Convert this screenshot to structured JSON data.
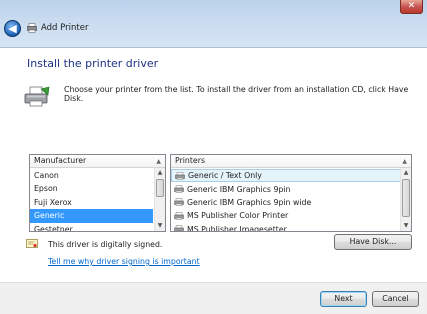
{
  "window": {
    "title": "Add Printer",
    "close_label": "✕"
  },
  "page": {
    "heading": "Install the printer driver",
    "instruction": "Choose your printer from the list. To install the driver from an installation CD, click Have Disk."
  },
  "manufacturer_list": {
    "header": "Manufacturer",
    "items": [
      "Canon",
      "Epson",
      "Fuji Xerox",
      "Generic",
      "Gestetner"
    ],
    "selected": "Generic"
  },
  "printer_list": {
    "header": "Printers",
    "items": [
      "Generic / Text Only",
      "Generic IBM Graphics 9pin",
      "Generic IBM Graphics 9pin wide",
      "MS Publisher Color Printer",
      "MS Publisher Imagesetter"
    ],
    "selected": "Generic / Text Only"
  },
  "signing": {
    "status": "This driver is digitally signed.",
    "link": "Tell me why driver signing is important"
  },
  "buttons": {
    "have_disk": "Have Disk...",
    "next": "Next",
    "cancel": "Cancel"
  },
  "icons": {
    "back": "back-arrow-icon",
    "title": "printer-icon",
    "close": "close-icon",
    "signed": "certificate-icon"
  },
  "colors": {
    "heading": "#1e3287",
    "selection": "#3399ff",
    "link": "#0066cc"
  }
}
